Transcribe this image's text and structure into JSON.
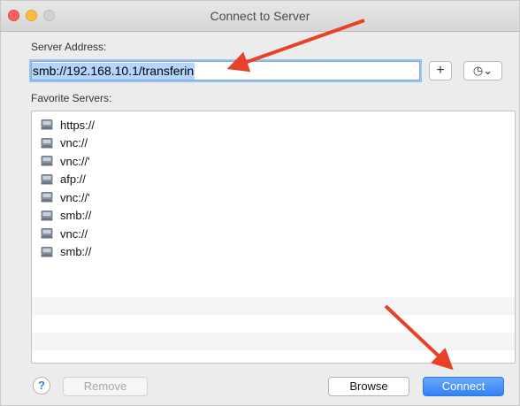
{
  "window": {
    "title": "Connect to Server"
  },
  "server_address": {
    "label": "Server Address:",
    "value": "smb://192.168.10.1/transferin",
    "add_button_label": "+",
    "recent_button_label": "◷⌄"
  },
  "favorites": {
    "label": "Favorite Servers:",
    "items": [
      {
        "text": "https://"
      },
      {
        "text": "vnc://"
      },
      {
        "text": "vnc://'"
      },
      {
        "text": "afp://"
      },
      {
        "text": "vnc://'"
      },
      {
        "text": "smb://"
      },
      {
        "text": "vnc://"
      },
      {
        "text": "smb://"
      }
    ]
  },
  "buttons": {
    "help": "?",
    "remove": "Remove",
    "browse": "Browse",
    "connect": "Connect"
  },
  "colors": {
    "accent": "#3b86f7",
    "annotation_arrow": "#e8412a"
  },
  "icons": {
    "server_item": "network-server-icon"
  }
}
